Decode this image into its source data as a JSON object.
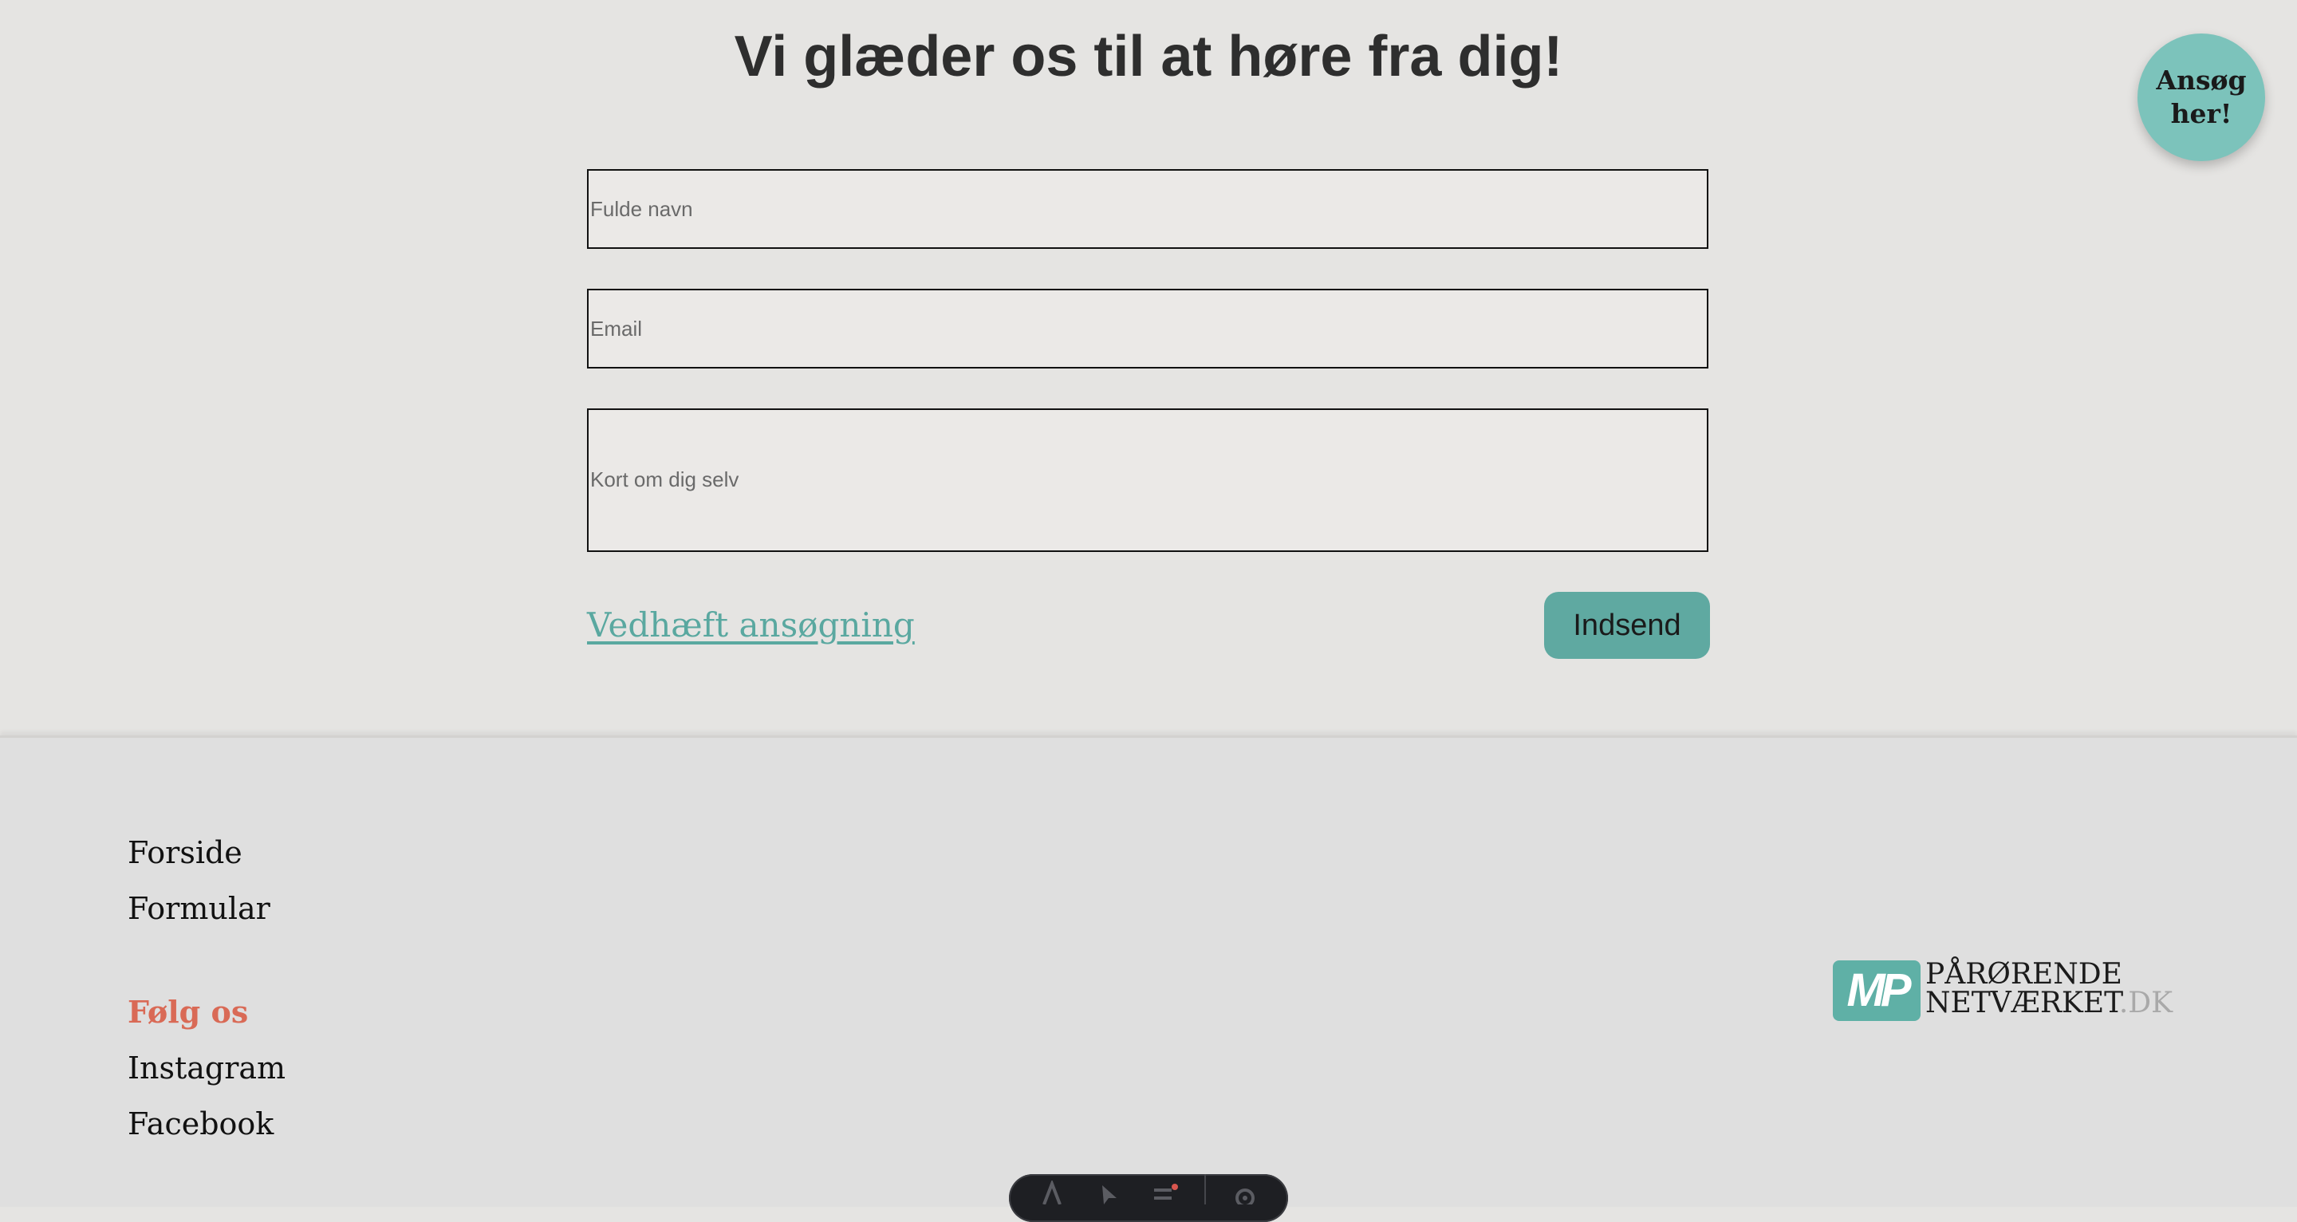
{
  "page": {
    "heading": "Vi glæder os til at høre fra dig!",
    "apply_bubble": "Ansøg her!"
  },
  "form": {
    "name_placeholder": "Fulde navn",
    "email_placeholder": "Email",
    "about_placeholder": "Kort om dig selv",
    "attach_label": "Vedhæft ansøgning",
    "submit_label": "Indsend"
  },
  "footer": {
    "nav": [
      "Forside",
      "Formular"
    ],
    "follow_heading": "Følg os",
    "social": [
      "Instagram",
      "Facebook"
    ],
    "logo": {
      "mark": "MP",
      "line1": "PÅRØRENDE",
      "line2": "NETVÆRKET",
      "suffix": ".DK"
    }
  },
  "toolbar": {
    "icons": [
      "text-icon",
      "pointer-icon",
      "list-icon",
      "gear-icon"
    ]
  },
  "colors": {
    "background": "#e5e4e2",
    "footer": "#dfdfdf",
    "accent_teal": "#5fa9a1",
    "bubble": "#7cc3bb",
    "follow_red": "#d96a56",
    "link_teal": "#5aa8a0"
  }
}
